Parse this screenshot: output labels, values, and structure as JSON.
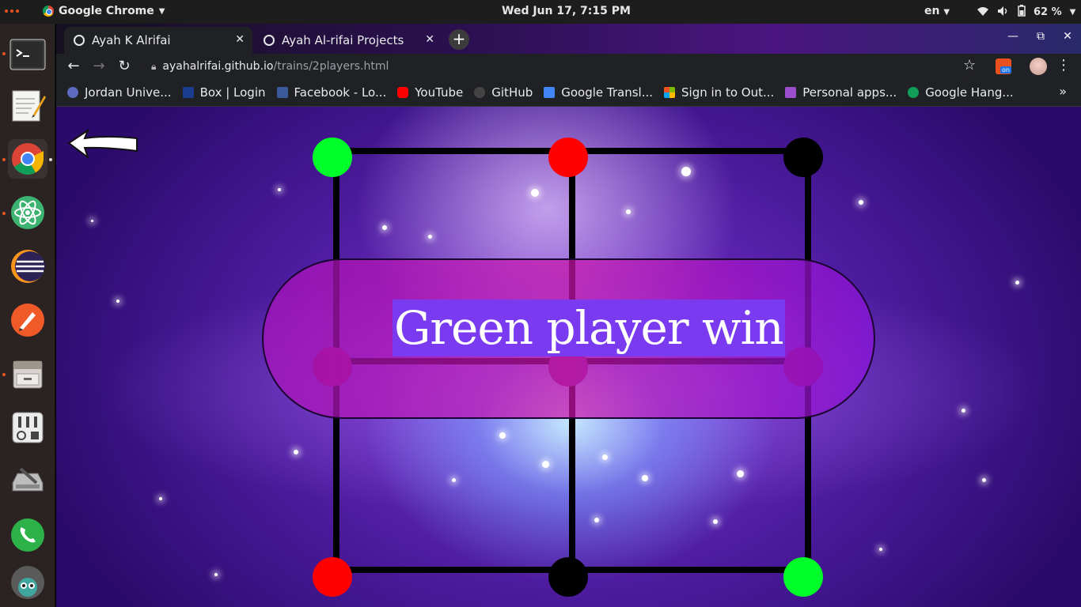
{
  "system": {
    "app_name": "Google Chrome",
    "clock": "Wed Jun 17,  7:15 PM",
    "language": "en",
    "battery": "62 %"
  },
  "tabs": [
    {
      "label": "Ayah K Alrifai",
      "active": true
    },
    {
      "label": "Ayah Al-rifai Projects",
      "active": false
    }
  ],
  "address": {
    "host": "ayahalrifai.github.io",
    "path": "/trains/2players.html"
  },
  "bookmarks": [
    {
      "label": "Jordan Unive...",
      "icon": "jordan-university-icon",
      "color": "#5c6bc0"
    },
    {
      "label": "Box | Login",
      "icon": "box-icon",
      "color": "#1a3d8f"
    },
    {
      "label": "Facebook - Lo...",
      "icon": "facebook-icon",
      "color": "#3b5998"
    },
    {
      "label": "YouTube",
      "icon": "youtube-icon",
      "color": "#ff0000"
    },
    {
      "label": "GitHub",
      "icon": "github-icon",
      "color": "#444444"
    },
    {
      "label": "Google Transl...",
      "icon": "google-translate-icon",
      "color": "#4285f4"
    },
    {
      "label": "Sign in to Out...",
      "icon": "microsoft-icon",
      "color": "#f25022"
    },
    {
      "label": "Personal apps...",
      "icon": "personal-apps-icon",
      "color": "#9c4dcc"
    },
    {
      "label": "Google Hang...",
      "icon": "hangouts-icon",
      "color": "#0f9d58"
    }
  ],
  "dock": [
    "terminal-icon",
    "text-editor-icon",
    "chrome-icon",
    "atom-icon",
    "eclipse-icon",
    "pen-app-icon",
    "file-manager-icon",
    "settings-tweaks-icon",
    "disk-utility-icon",
    "phone-app-icon",
    "avatar-app-icon"
  ],
  "game": {
    "message": "Green player win",
    "pieces": [
      {
        "spot": "top-left",
        "color": "#00ff2a"
      },
      {
        "spot": "top-center",
        "color": "#ff0000"
      },
      {
        "spot": "top-right",
        "color": "#000000"
      },
      {
        "spot": "mid-left",
        "color": "#8a1070"
      },
      {
        "spot": "center",
        "color": "#7a2a90"
      },
      {
        "spot": "mid-right",
        "color": "#8a1070"
      },
      {
        "spot": "bottom-left",
        "color": "#ff0000"
      },
      {
        "spot": "bottom-center",
        "color": "#000000"
      },
      {
        "spot": "bottom-right",
        "color": "#00ff2a"
      }
    ]
  }
}
